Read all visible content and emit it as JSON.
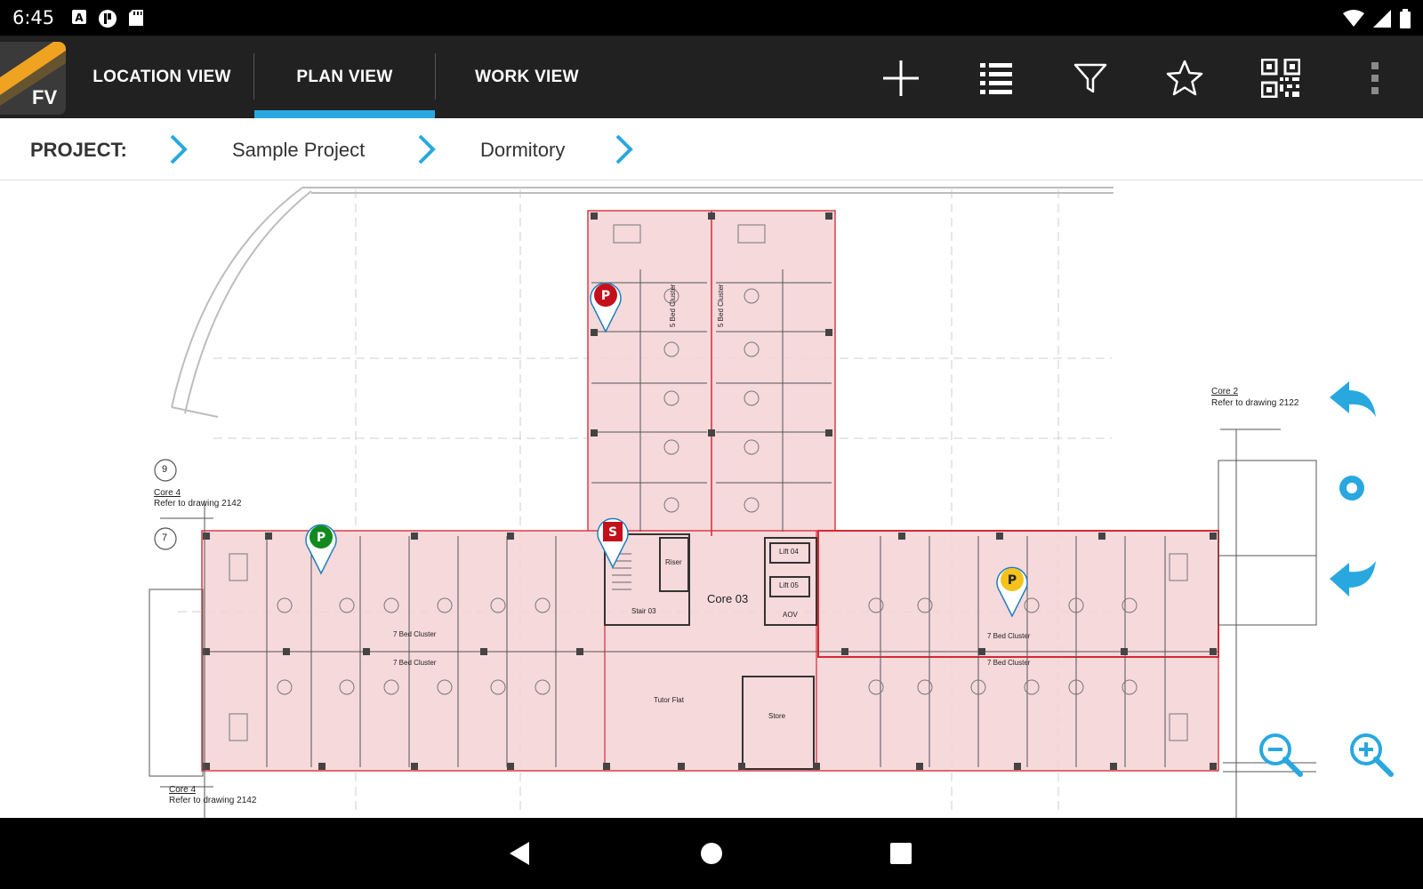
{
  "status_bar": {
    "time": "6:45"
  },
  "app": {
    "logo_text": "FV"
  },
  "tabs": [
    {
      "label": "LOCATION VIEW",
      "active": false
    },
    {
      "label": "PLAN VIEW",
      "active": true
    },
    {
      "label": "WORK VIEW",
      "active": false
    }
  ],
  "toolbar": {
    "icons": [
      "add-icon",
      "list-icon",
      "filter-icon",
      "star-icon",
      "qr-code-icon",
      "more-vert-icon"
    ]
  },
  "breadcrumb": {
    "label": "PROJECT:",
    "items": [
      "Sample Project",
      "Dormitory"
    ]
  },
  "plan": {
    "labels": {
      "core03": "Core 03",
      "core2": "Core 2",
      "core2_ref": "Refer to drawing 2122",
      "core4": "Core 4",
      "core4_ref": "Refer to drawing 2142",
      "core4b": "Core 4",
      "core4b_ref": "Refer to drawing 2142",
      "grid9": "9",
      "grid7": "7",
      "lift04": "Lift 04",
      "lift05": "Lift 05",
      "aov": "AOV",
      "riser": "Riser",
      "stair03": "Stair 03",
      "tutor_flat": "Tutor Flat",
      "store": "Store",
      "cluster_7a": "7 Bed Cluster",
      "cluster_7b": "7 Bed Cluster",
      "cluster_7c": "7 Bed Cluster",
      "cluster_7d": "7 Bed Cluster",
      "cluster_5a": "5 Bed Cluster",
      "cluster_5b": "5 Bed Cluster"
    },
    "pins": [
      {
        "letter": "P",
        "color": "#c4101b",
        "shape": "circle"
      },
      {
        "letter": "P",
        "color": "#128a1e",
        "shape": "circle"
      },
      {
        "letter": "S",
        "color": "#c4101b",
        "shape": "square"
      },
      {
        "letter": "P",
        "color": "#f5c21b",
        "shape": "circle"
      }
    ]
  },
  "colors": {
    "accent": "#29a8e0",
    "appbar": "#212121",
    "zone_fill": "#f6d5d8",
    "zone_stroke": "#d42a35"
  }
}
